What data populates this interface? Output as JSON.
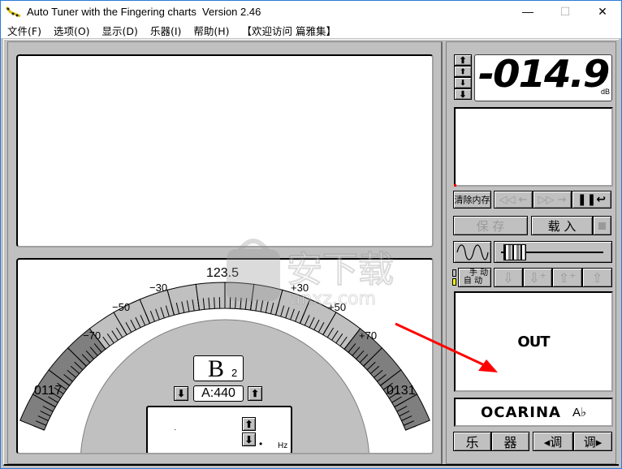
{
  "window": {
    "title": "Auto Tuner with the Fingering charts  Version 2.46",
    "controls": {
      "minimize": "—",
      "maximize": "☐",
      "close": "✕"
    }
  },
  "menu": {
    "items": [
      {
        "label": "文件(F)"
      },
      {
        "label": "选项(O)"
      },
      {
        "label": "显示(D)"
      },
      {
        "label": "乐器(I)"
      },
      {
        "label": "帮助(H)"
      },
      {
        "label": "【欢迎访问 篇雅集】"
      }
    ]
  },
  "meter": {
    "center_label": "123.5",
    "left_freq": "0117",
    "right_freq": "0131",
    "scale_labels": [
      "−70",
      "−50",
      "−30",
      "+30",
      "+50",
      "+70"
    ],
    "note": "B",
    "octave": "2",
    "reference": "A:440",
    "hz_unit": "Hz",
    "cents_range": [
      -90,
      90
    ]
  },
  "right_panel": {
    "level_value": "-014.9",
    "level_unit": "dB",
    "clear_memory": "清除内存",
    "rewind": "◁◁ ←",
    "forward": "▷▷ →",
    "pause": "❚❚↩",
    "save": "保  存",
    "load": "载  入",
    "manual": "手  动",
    "auto": "自  动",
    "out_label": "OUT",
    "instrument_name": "OCARINA",
    "instrument_key": "A♭",
    "instrument_btn_1": "乐",
    "instrument_btn_2": "器",
    "key_prev": "◂调",
    "key_next": "调▸",
    "slider_position": 0.05
  },
  "colors": {
    "face": "#c0c0c0",
    "dark_segment": "#7f7f7f",
    "light_segment": "#c0c0c0",
    "auto_indicator": "#ffff00",
    "accent_red": "#ff0000"
  }
}
